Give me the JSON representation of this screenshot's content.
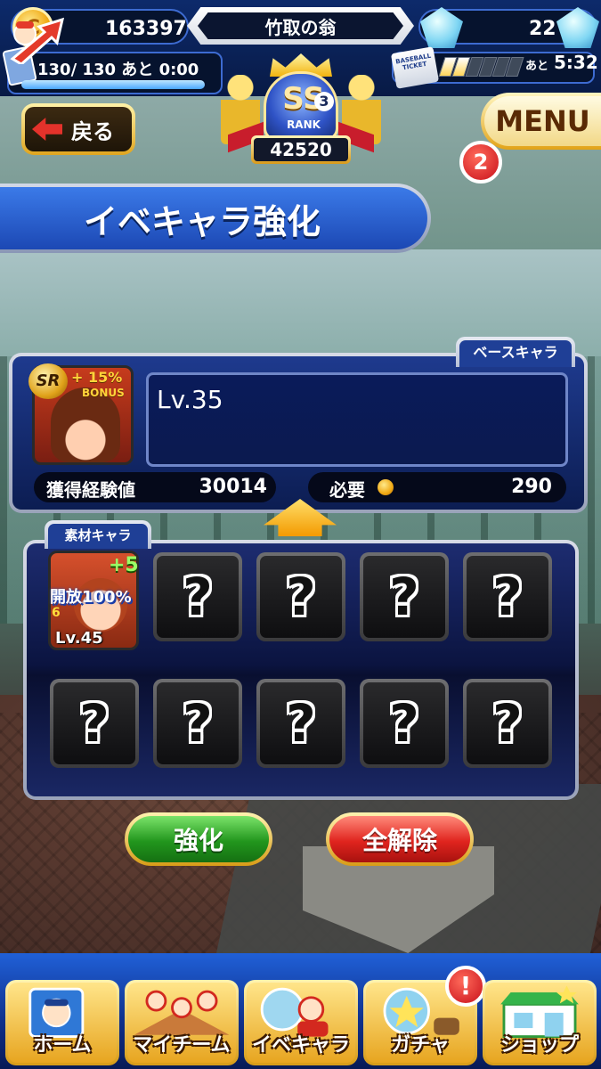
{
  "header": {
    "coins": "163397",
    "player_name": "竹取の翁",
    "gems": "22",
    "stamina": "130/ 130",
    "stamina_countdown_label": "あと",
    "stamina_countdown": "0:00",
    "stamina_fraction": 1.0,
    "ticket_label": "BASEBALL TICKET",
    "ticket_segments_filled": 2,
    "ticket_segments_total": 6,
    "ticket_countdown_label": "あと",
    "ticket_countdown": "5:32"
  },
  "rank": {
    "grade": "SS",
    "grade_level": "3",
    "label": "RANK",
    "score": "42520"
  },
  "nav": {
    "back_label": "戻る",
    "menu_label": "MENU",
    "menu_badge": "2"
  },
  "screen_title": "イベキャラ強化",
  "base_character": {
    "section_label": "ベースキャラ",
    "rarity": "SR",
    "bonus_percent": "+ 15%",
    "bonus_word": "BONUS",
    "level_text": "Lv.35",
    "exp_label": "獲得経験値",
    "exp_value": "30014",
    "cost_label": "必要",
    "cost_value": "290"
  },
  "materials": {
    "section_label": "素材キャラ",
    "selected": {
      "plus": "+5",
      "unlock_label": "開放100%",
      "rank_num": "6",
      "level": "Lv.45"
    },
    "empty_slot_symbol": "?",
    "empty_slot_count": 9
  },
  "actions": {
    "enhance_label": "強化",
    "clear_all_label": "全解除"
  },
  "bottom_nav": {
    "items": [
      {
        "label": "ホーム",
        "icon": "home-book-icon"
      },
      {
        "label": "マイチーム",
        "icon": "team-icon"
      },
      {
        "label": "イベキャラ",
        "icon": "event-character-icon"
      },
      {
        "label": "ガチャ",
        "icon": "gacha-icon"
      },
      {
        "label": "ショップ",
        "icon": "shop-icon"
      }
    ],
    "gacha_alert": "!"
  },
  "colors": {
    "header_bg": "#0d2a6b",
    "panel_blue": "#1e3a8e",
    "gold": "#e0a51f",
    "enhance_green": "#22961d",
    "clear_red": "#e0241e",
    "badge_red": "#c8101a"
  }
}
